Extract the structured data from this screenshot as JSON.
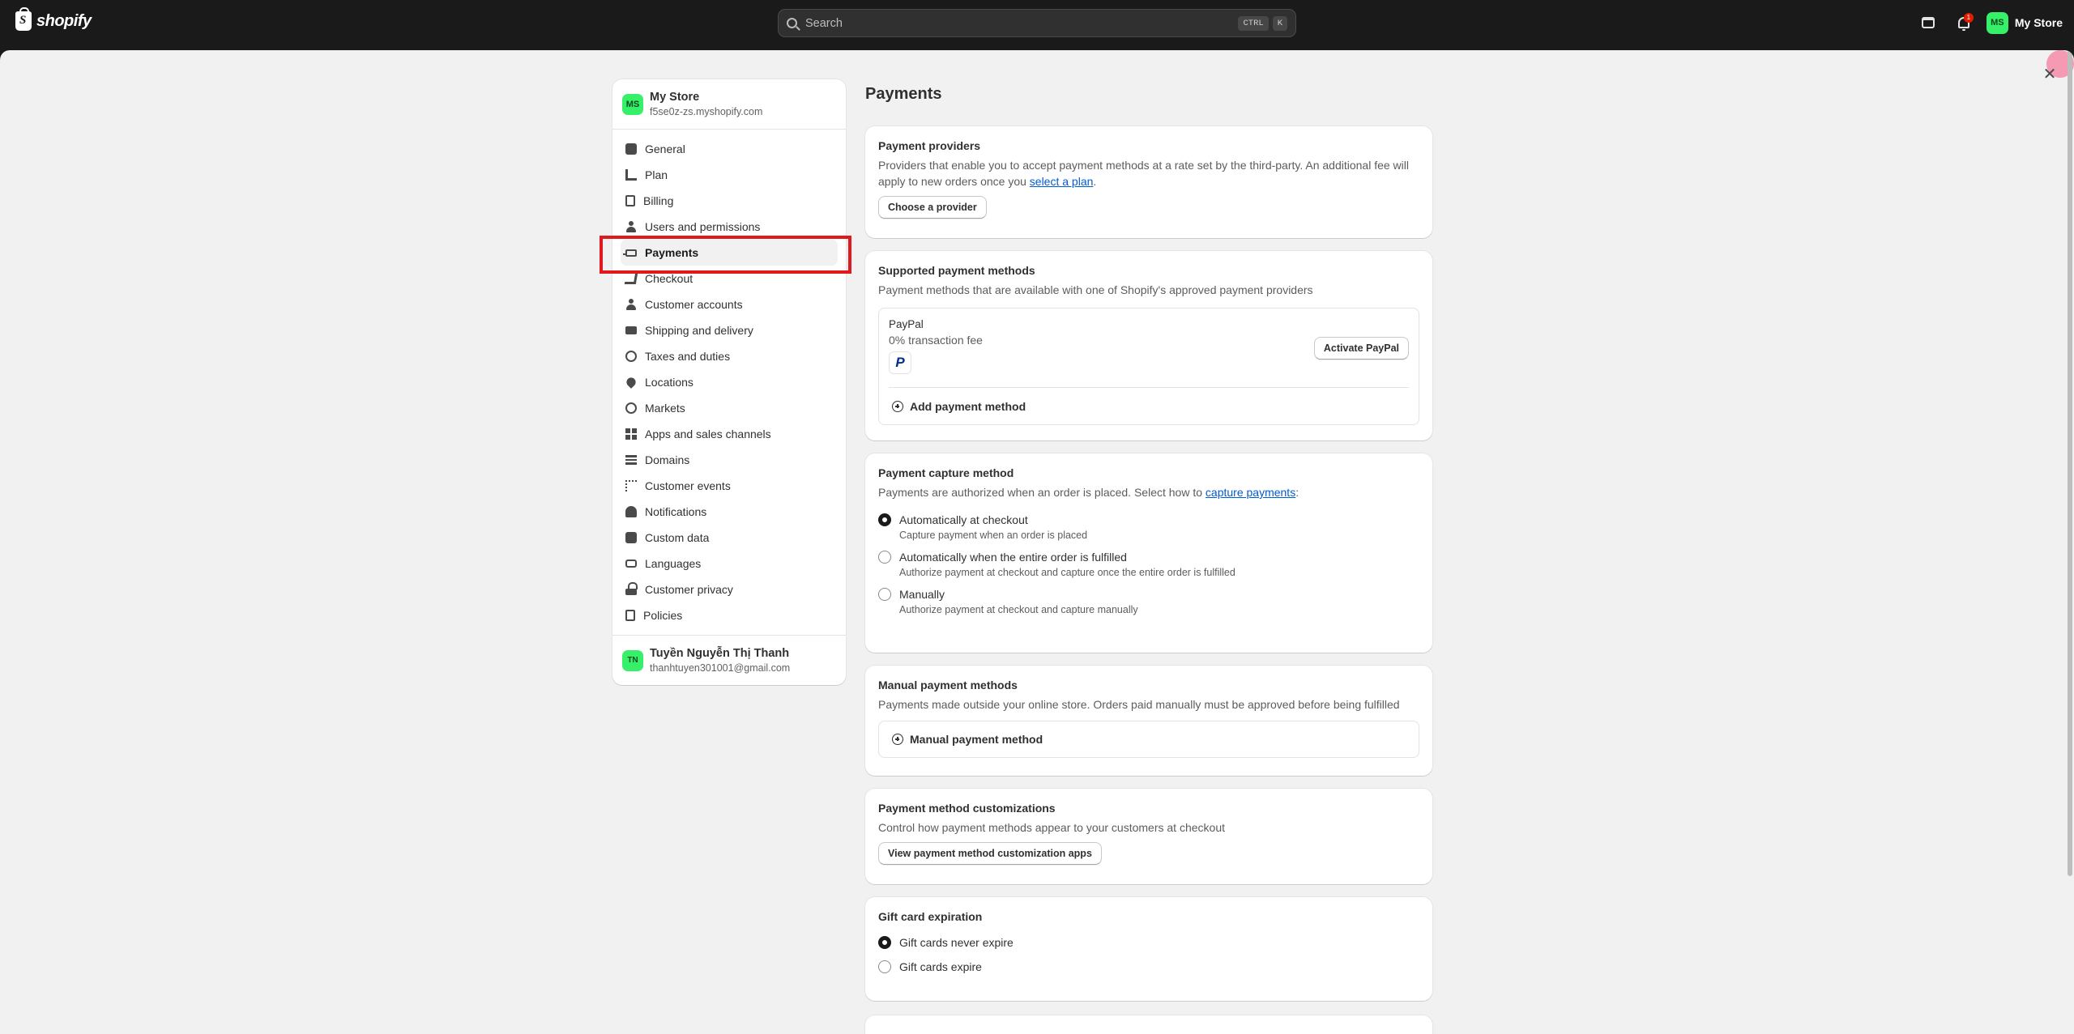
{
  "topbar": {
    "logo_text": "shopify",
    "search_placeholder": "Search",
    "search_key1": "CTRL",
    "search_key2": "K",
    "notif_count": "1",
    "user_initials": "MS",
    "user_name": "My Store"
  },
  "sidebar": {
    "store_initials": "MS",
    "store_name": "My Store",
    "store_domain": "f5se0z-zs.myshopify.com",
    "items": [
      {
        "label": "General",
        "icon": "store-icon"
      },
      {
        "label": "Plan",
        "icon": "plan-icon"
      },
      {
        "label": "Billing",
        "icon": "billing-icon"
      },
      {
        "label": "Users and permissions",
        "icon": "users-icon"
      },
      {
        "label": "Payments",
        "icon": "payments-icon"
      },
      {
        "label": "Checkout",
        "icon": "cart-icon"
      },
      {
        "label": "Customer accounts",
        "icon": "person-icon"
      },
      {
        "label": "Shipping and delivery",
        "icon": "truck-icon"
      },
      {
        "label": "Taxes and duties",
        "icon": "tax-icon"
      },
      {
        "label": "Locations",
        "icon": "location-icon"
      },
      {
        "label": "Markets",
        "icon": "globe-icon"
      },
      {
        "label": "Apps and sales channels",
        "icon": "apps-icon"
      },
      {
        "label": "Domains",
        "icon": "domain-icon"
      },
      {
        "label": "Customer events",
        "icon": "cursor-icon"
      },
      {
        "label": "Notifications",
        "icon": "bell-icon"
      },
      {
        "label": "Custom data",
        "icon": "custom-data-icon"
      },
      {
        "label": "Languages",
        "icon": "language-icon"
      },
      {
        "label": "Customer privacy",
        "icon": "lock-icon"
      },
      {
        "label": "Policies",
        "icon": "policy-icon"
      }
    ],
    "active_item": "Payments",
    "user_initials": "TN",
    "user_name": "Tuyền Nguyễn Thị Thanh",
    "user_email": "thanhtuyen301001@gmail.com"
  },
  "main": {
    "title": "Payments",
    "providers": {
      "heading": "Payment providers",
      "text_before": "Providers that enable you to accept payment methods at a rate set by the third-party. An additional fee will apply to new orders once you ",
      "link": "select a plan",
      "text_after": ".",
      "button": "Choose a provider"
    },
    "supported": {
      "heading": "Supported payment methods",
      "text": "Payment methods that are available with one of Shopify's approved payment providers",
      "paypal_name": "PayPal",
      "paypal_fee": "0% transaction fee",
      "activate_button": "Activate PayPal",
      "add_method": "Add payment method"
    },
    "capture": {
      "heading": "Payment capture method",
      "text_before": "Payments are authorized when an order is placed. Select how to ",
      "link": "capture payments",
      "text_after": ":",
      "options": [
        {
          "label": "Automatically at checkout",
          "help": "Capture payment when an order is placed",
          "selected": true
        },
        {
          "label": "Automatically when the entire order is fulfilled",
          "help": "Authorize payment at checkout and capture once the entire order is fulfilled",
          "selected": false
        },
        {
          "label": "Manually",
          "help": "Authorize payment at checkout and capture manually",
          "selected": false
        }
      ]
    },
    "manual": {
      "heading": "Manual payment methods",
      "text": "Payments made outside your online store. Orders paid manually must be approved before being fulfilled",
      "add": "Manual payment method"
    },
    "customizations": {
      "heading": "Payment method customizations",
      "text": "Control how payment methods appear to your customers at checkout",
      "button": "View payment method customization apps"
    },
    "giftcard": {
      "heading": "Gift card expiration",
      "options": [
        {
          "label": "Gift cards never expire",
          "selected": true
        },
        {
          "label": "Gift cards expire",
          "selected": false
        }
      ]
    }
  }
}
